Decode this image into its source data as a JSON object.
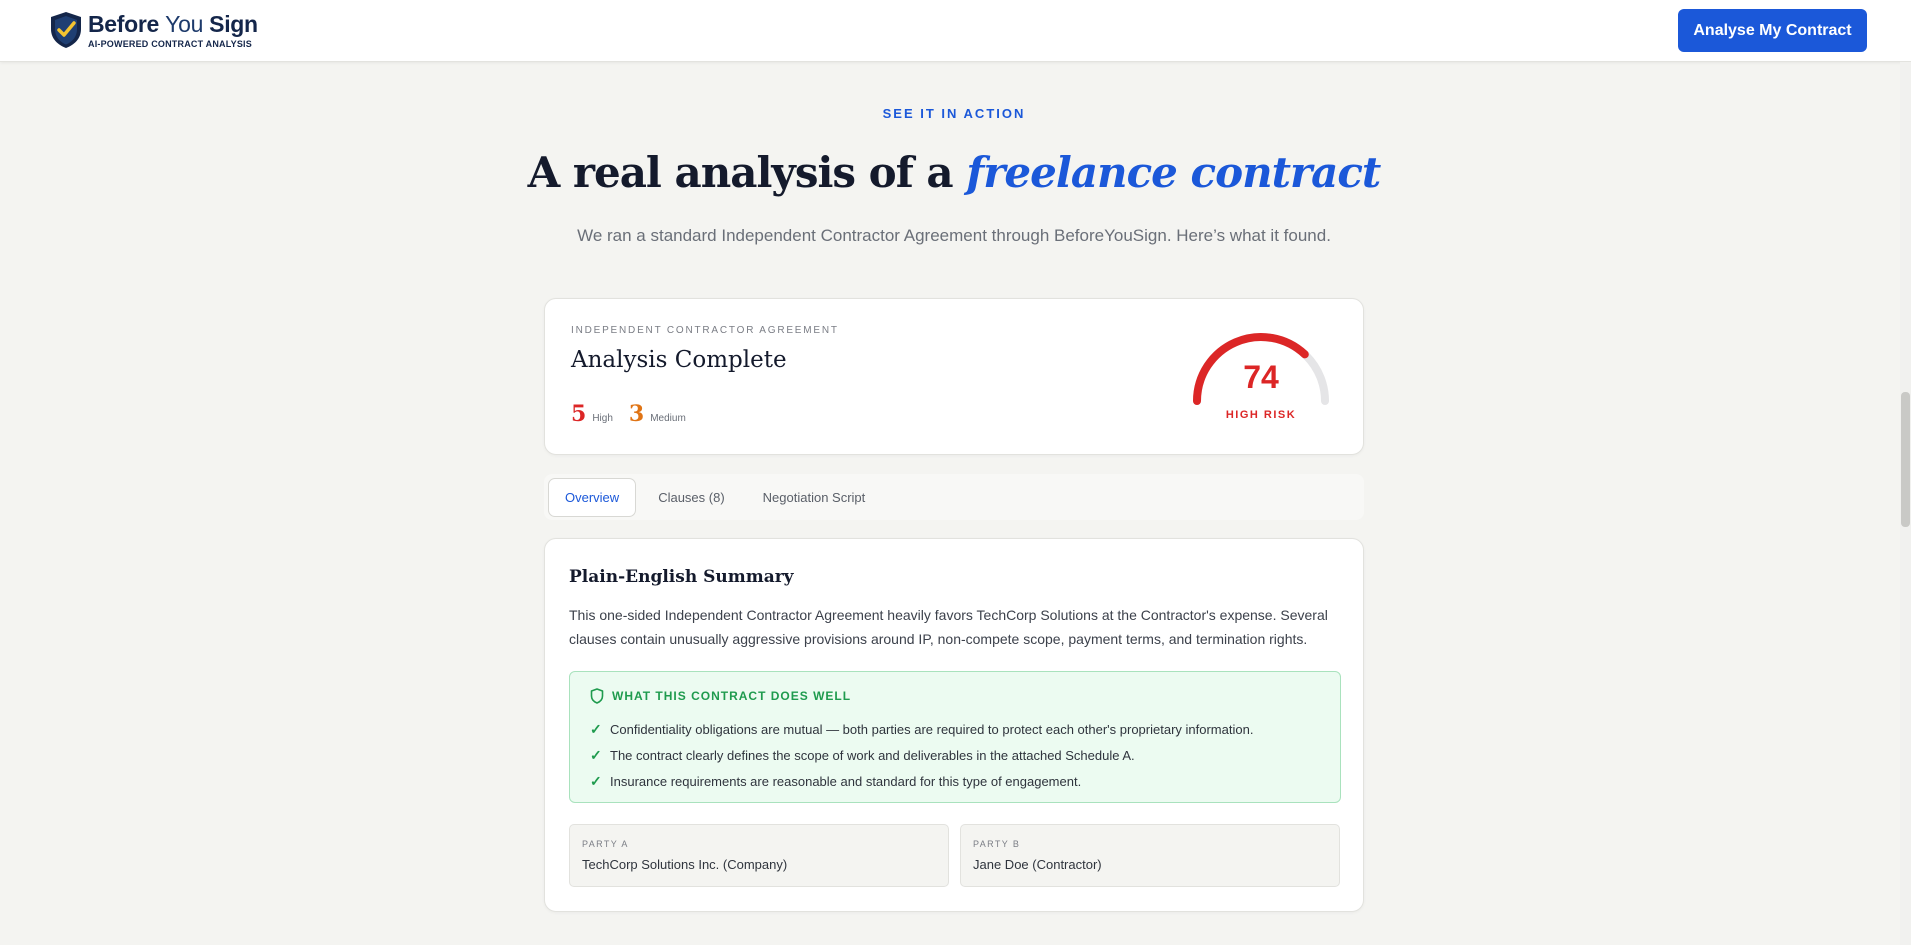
{
  "header": {
    "brand_name_1": "Before",
    "brand_name_2": "You",
    "brand_name_3": "Sign",
    "brand_tagline": "AI-POWERED CONTRACT ANALYSIS",
    "cta_label": "Analyse My Contract",
    "brand_color": "#1b58d9"
  },
  "hero": {
    "eyebrow": "SEE IT IN ACTION",
    "headline_plain": "A real analysis of a ",
    "headline_accent": "freelance contract",
    "subtitle": "We ran a standard Independent Contractor Agreement through BeforeYouSign. Here’s what it found."
  },
  "result": {
    "doc_type": "INDEPENDENT CONTRACTOR AGREEMENT",
    "title": "Analysis Complete",
    "high_count": "5",
    "high_label": "High",
    "medium_count": "3",
    "medium_label": "Medium",
    "risk_score": "74",
    "risk_fraction": 0.74,
    "risk_label": "HIGH RISK",
    "risk_color": "#dc2626"
  },
  "tabs": [
    {
      "label": "Overview"
    },
    {
      "label": "Clauses (8)"
    },
    {
      "label": "Negotiation Script"
    }
  ],
  "overview": {
    "section_title": "Plain-English Summary",
    "summary": "This one-sided Independent Contractor Agreement heavily favors TechCorp Solutions at the Contractor's expense. Several clauses contain unusually aggressive provisions around IP, non-compete scope, payment terms, and termination rights.",
    "well_title": "WHAT THIS CONTRACT DOES WELL",
    "well_items": [
      "Confidentiality obligations are mutual — both parties are required to protect each other's proprietary information.",
      "The contract clearly defines the scope of work and deliverables in the attached Schedule A.",
      "Insurance requirements are reasonable and standard for this type of engagement."
    ],
    "party_a_label": "PARTY A",
    "party_a_value": "TechCorp Solutions Inc. (Company)",
    "party_b_label": "PARTY B",
    "party_b_value": "Jane Doe (Contractor)"
  }
}
